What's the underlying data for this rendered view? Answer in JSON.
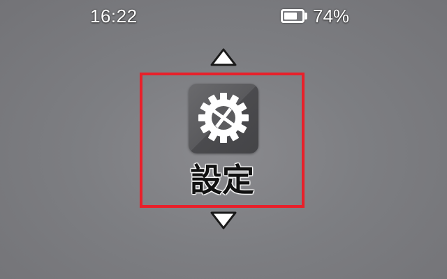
{
  "status_bar": {
    "time": "16:22",
    "battery_percent_label": "74%",
    "battery_level": 0.74,
    "battery_icon": "battery-icon"
  },
  "menu": {
    "prev_arrow_icon": "triangle-up-icon",
    "next_arrow_icon": "triangle-down-icon",
    "selected_item": {
      "label": "設定",
      "icon": "gear-icon"
    }
  },
  "colors": {
    "selection_border": "#e8202a",
    "icon_tile": "#58585b",
    "text_light": "#ffffff",
    "text_dark": "#111111"
  }
}
